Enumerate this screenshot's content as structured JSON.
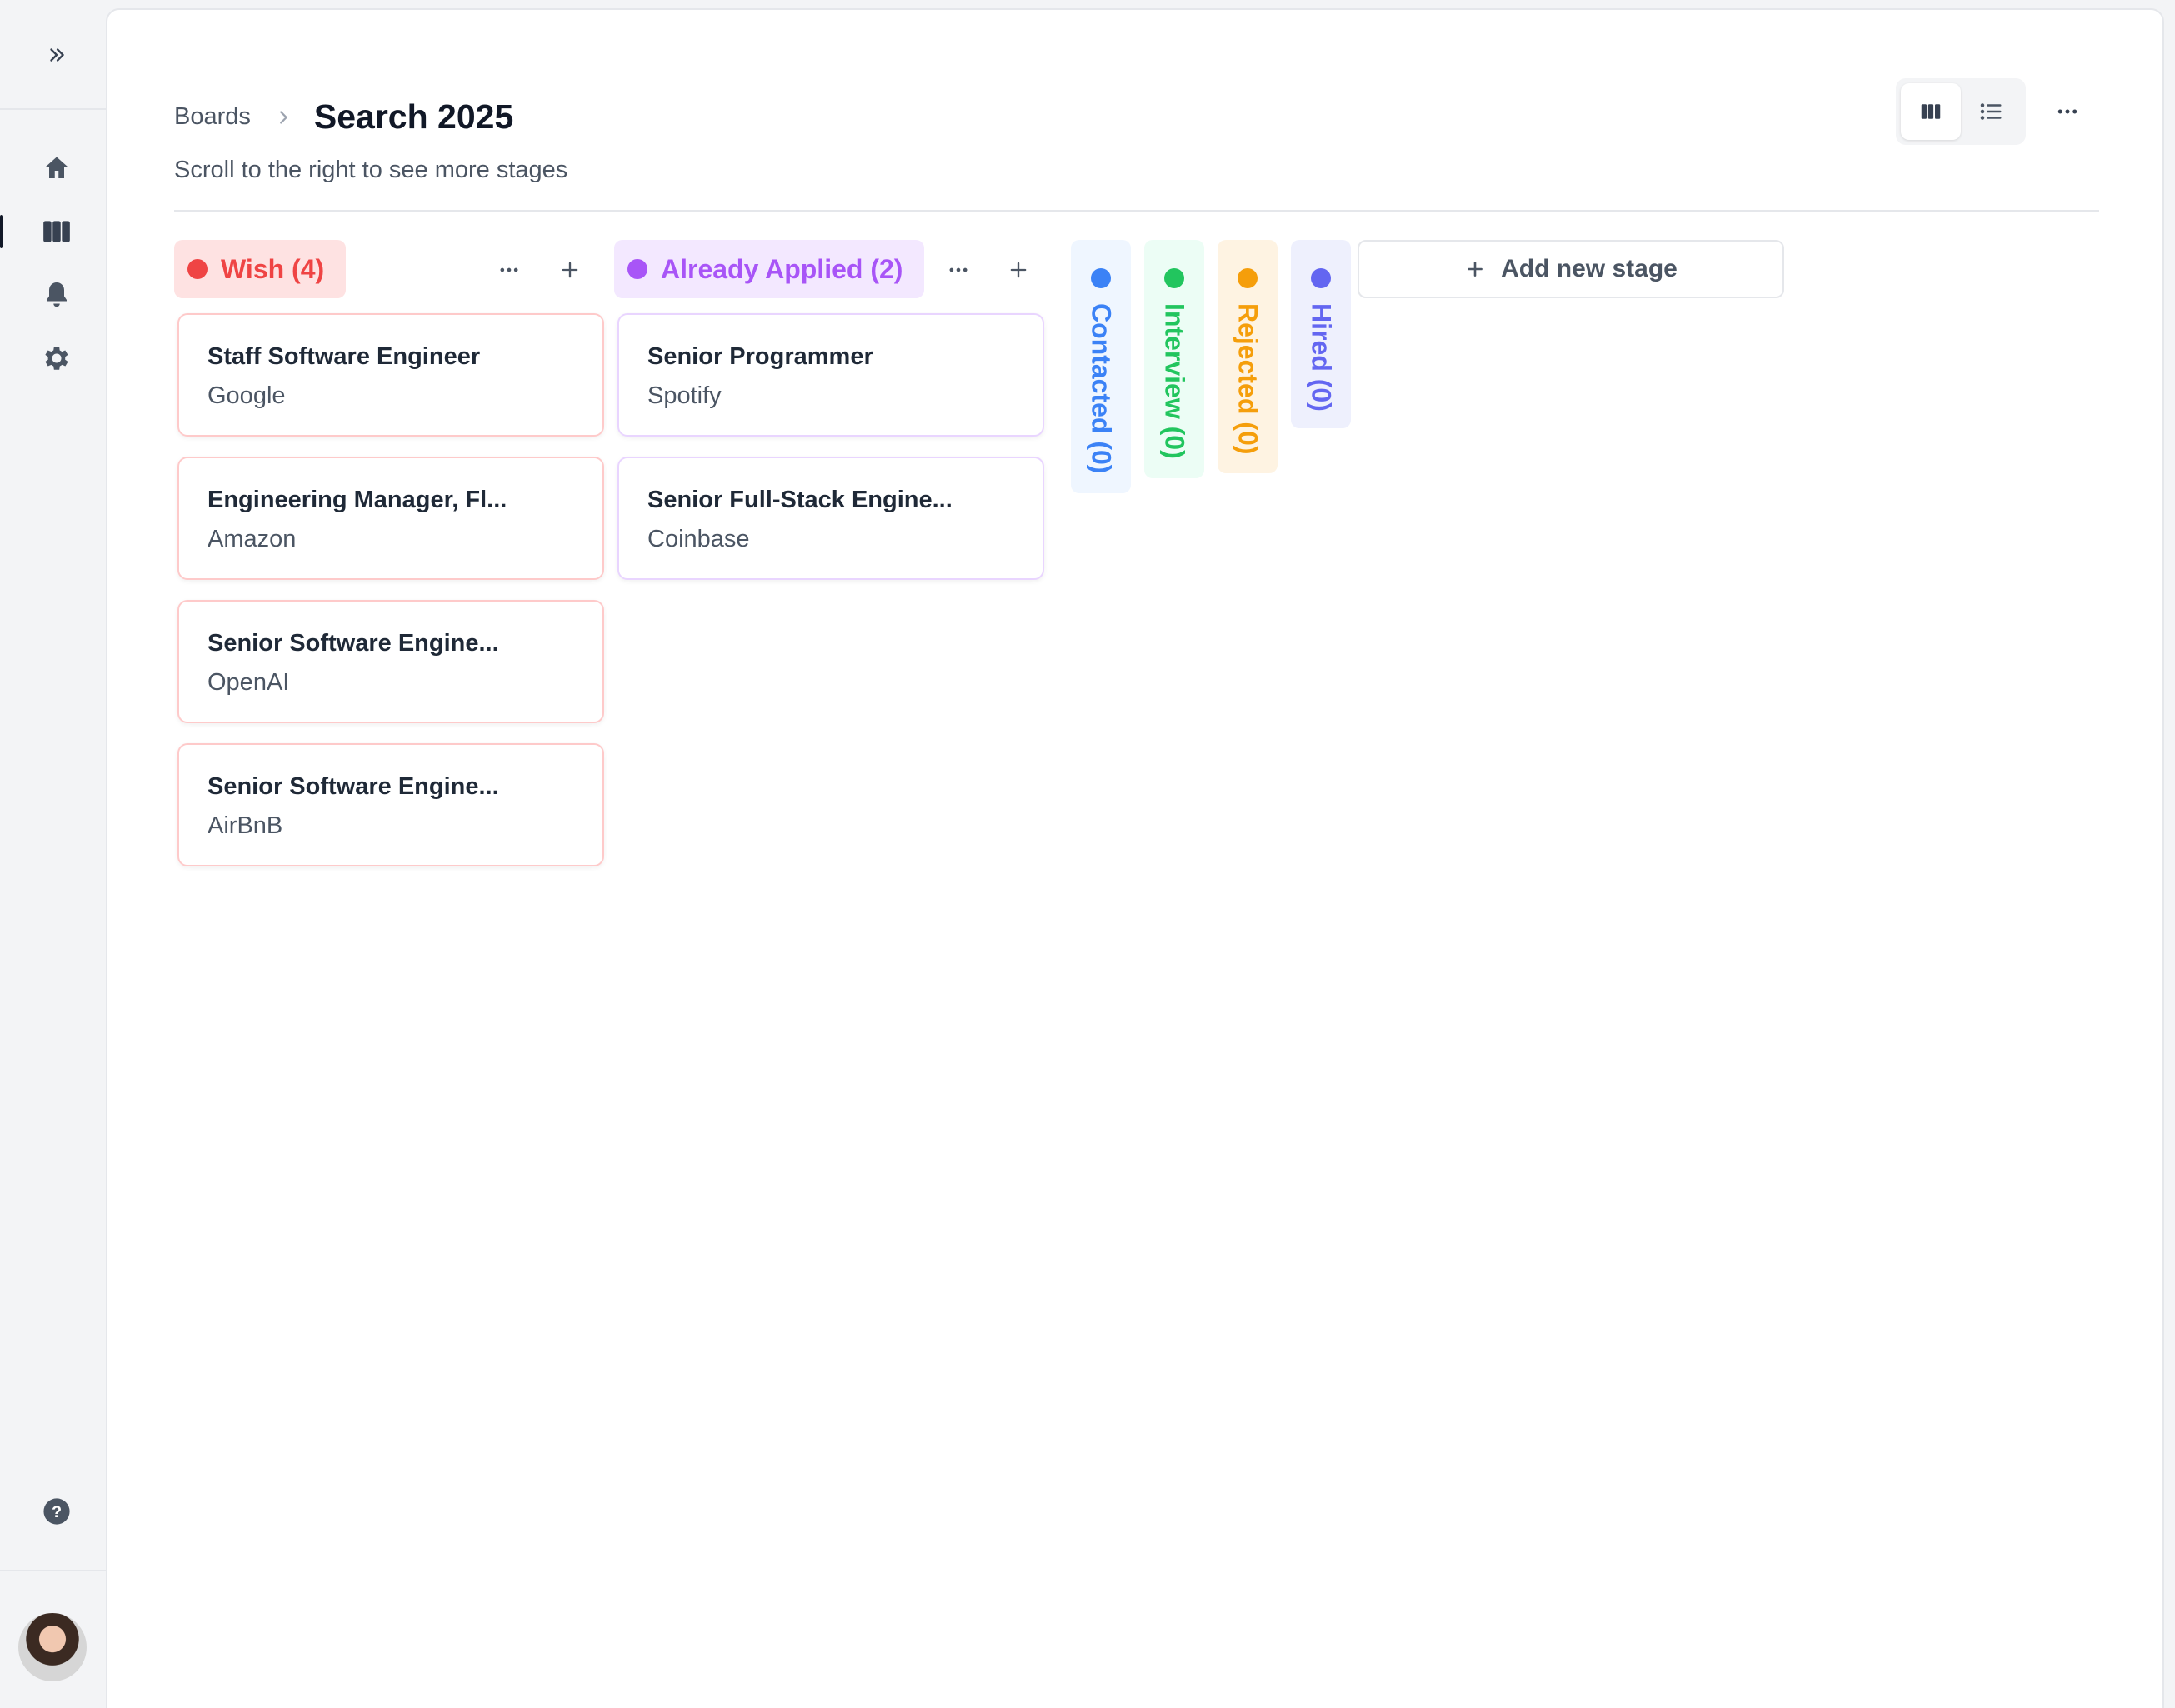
{
  "sidebar": {
    "items": [
      {
        "name": "home-icon"
      },
      {
        "name": "board-icon"
      },
      {
        "name": "bell-icon"
      },
      {
        "name": "gear-icon"
      }
    ],
    "help_icon": "help-icon",
    "avatar": "user-avatar"
  },
  "header": {
    "breadcrumb_root": "Boards",
    "title": "Search 2025",
    "subtitle": "Scroll to the right to see more stages",
    "view_modes": [
      "board",
      "list"
    ],
    "active_view": "board"
  },
  "columns": [
    {
      "title": "Wish (4)",
      "color": "#ef4444",
      "bg": "#fee2e2",
      "cards": [
        {
          "title": "Staff Software Engineer",
          "company": "Google"
        },
        {
          "title": "Engineering Manager, Fl...",
          "company": "Amazon"
        },
        {
          "title": "Senior Software Engine...",
          "company": "OpenAI"
        },
        {
          "title": "Senior Software Engine...",
          "company": "AirBnB"
        }
      ]
    },
    {
      "title": "Already Applied (2)",
      "color": "#a855f7",
      "bg": "#f3e8ff",
      "cards": [
        {
          "title": "Senior Programmer",
          "company": "Spotify"
        },
        {
          "title": "Senior Full-Stack Engine...",
          "company": "Coinbase"
        }
      ]
    }
  ],
  "collapsed_stages": [
    {
      "title": "Contacted (0)",
      "color": "#3b82f6",
      "bg": "#eff6ff"
    },
    {
      "title": "Interview (0)",
      "color": "#22c55e",
      "bg": "#ecfdf5"
    },
    {
      "title": "Rejected (0)",
      "color": "#f59e0b",
      "bg": "#fef3e2"
    },
    {
      "title": "Hired (0)",
      "color": "#6366f1",
      "bg": "#eef0fd"
    }
  ],
  "add_stage_label": "Add new stage"
}
